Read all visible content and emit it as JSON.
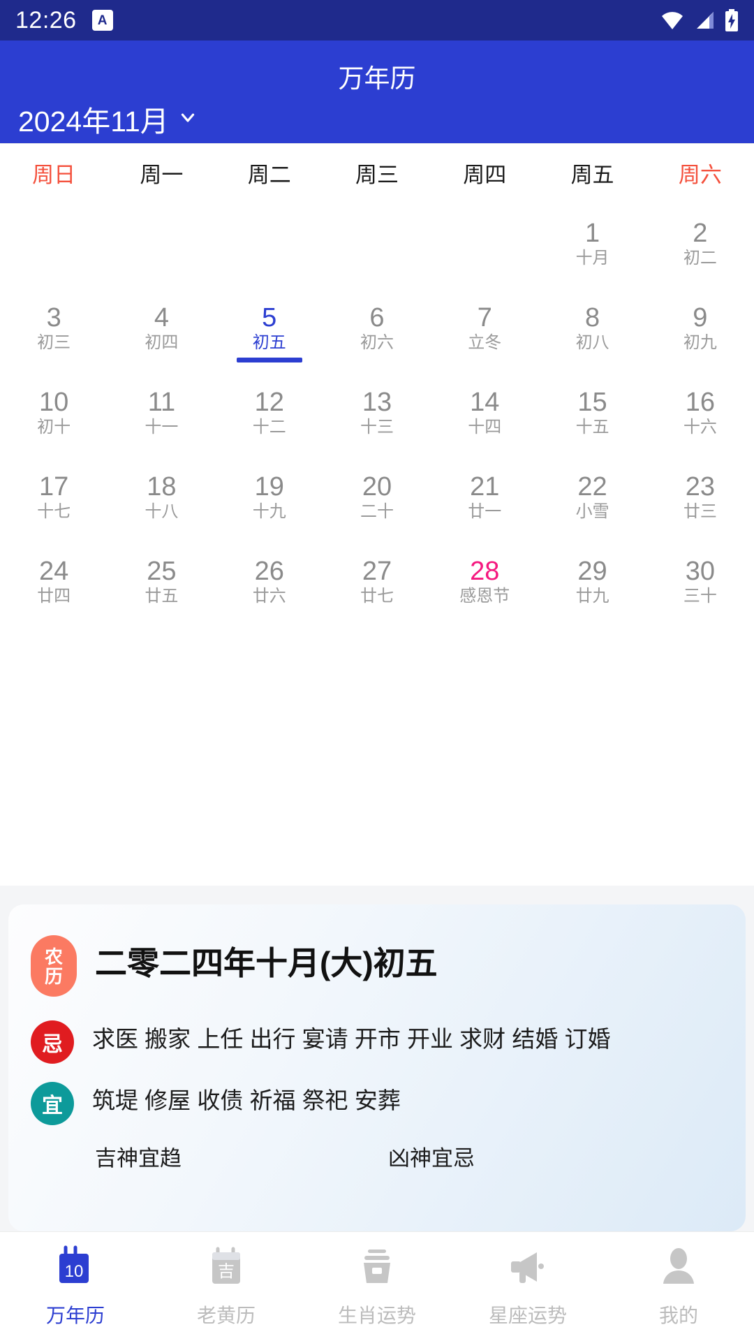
{
  "status_bar": {
    "time": "12:26",
    "app_icon_letter": "A",
    "icons": [
      "wifi-icon",
      "signal-icon",
      "battery-charging-icon"
    ]
  },
  "app_bar": {
    "title": "万年历",
    "month_label": "2024年11月",
    "chevron": "chevron-down-icon",
    "bg_color": "#2c3ed1"
  },
  "weekdays": [
    {
      "label": "周日",
      "weekend": true
    },
    {
      "label": "周一",
      "weekend": false
    },
    {
      "label": "周二",
      "weekend": false
    },
    {
      "label": "周三",
      "weekend": false
    },
    {
      "label": "周四",
      "weekend": false
    },
    {
      "label": "周五",
      "weekend": false
    },
    {
      "label": "周六",
      "weekend": true
    }
  ],
  "calendar": {
    "leading_blanks": 5,
    "days": [
      {
        "day": "1",
        "lunar": "十月",
        "selected": false,
        "festival": false
      },
      {
        "day": "2",
        "lunar": "初二",
        "selected": false,
        "festival": false
      },
      {
        "day": "3",
        "lunar": "初三",
        "selected": false,
        "festival": false
      },
      {
        "day": "4",
        "lunar": "初四",
        "selected": false,
        "festival": false
      },
      {
        "day": "5",
        "lunar": "初五",
        "selected": true,
        "festival": false
      },
      {
        "day": "6",
        "lunar": "初六",
        "selected": false,
        "festival": false
      },
      {
        "day": "7",
        "lunar": "立冬",
        "selected": false,
        "festival": false
      },
      {
        "day": "8",
        "lunar": "初八",
        "selected": false,
        "festival": false
      },
      {
        "day": "9",
        "lunar": "初九",
        "selected": false,
        "festival": false
      },
      {
        "day": "10",
        "lunar": "初十",
        "selected": false,
        "festival": false
      },
      {
        "day": "11",
        "lunar": "十一",
        "selected": false,
        "festival": false
      },
      {
        "day": "12",
        "lunar": "十二",
        "selected": false,
        "festival": false
      },
      {
        "day": "13",
        "lunar": "十三",
        "selected": false,
        "festival": false
      },
      {
        "day": "14",
        "lunar": "十四",
        "selected": false,
        "festival": false
      },
      {
        "day": "15",
        "lunar": "十五",
        "selected": false,
        "festival": false
      },
      {
        "day": "16",
        "lunar": "十六",
        "selected": false,
        "festival": false
      },
      {
        "day": "17",
        "lunar": "十七",
        "selected": false,
        "festival": false
      },
      {
        "day": "18",
        "lunar": "十八",
        "selected": false,
        "festival": false
      },
      {
        "day": "19",
        "lunar": "十九",
        "selected": false,
        "festival": false
      },
      {
        "day": "20",
        "lunar": "二十",
        "selected": false,
        "festival": false
      },
      {
        "day": "21",
        "lunar": "廿一",
        "selected": false,
        "festival": false
      },
      {
        "day": "22",
        "lunar": "小雪",
        "selected": false,
        "festival": false
      },
      {
        "day": "23",
        "lunar": "廿三",
        "selected": false,
        "festival": false
      },
      {
        "day": "24",
        "lunar": "廿四",
        "selected": false,
        "festival": false
      },
      {
        "day": "25",
        "lunar": "廿五",
        "selected": false,
        "festival": false
      },
      {
        "day": "26",
        "lunar": "廿六",
        "selected": false,
        "festival": false
      },
      {
        "day": "27",
        "lunar": "廿七",
        "selected": false,
        "festival": false
      },
      {
        "day": "28",
        "lunar": "感恩节",
        "selected": false,
        "festival": true
      },
      {
        "day": "29",
        "lunar": "廿九",
        "selected": false,
        "festival": false
      },
      {
        "day": "30",
        "lunar": "三十",
        "selected": false,
        "festival": false
      }
    ],
    "selected_color": "#2c3ed1",
    "festival_color": "#f5187f"
  },
  "lunar_card": {
    "badge_lunar_line1": "农",
    "badge_lunar_line2": "历",
    "title": "二零二四年十月(大)初五",
    "ji_badge": "忌",
    "ji_items": "求医 搬家 上任 出行 宴请 开市 开业 求财 结婚 订婚",
    "yi_badge": "宜",
    "yi_items": "筑堤 修屋 收债 祈福 祭祀 安葬",
    "good_gods_label": "吉神宜趋",
    "bad_gods_label": "凶神宜忌",
    "badge_lunar_color": "#fb7a62",
    "badge_ji_color": "#e01c20",
    "badge_yi_color": "#0d9a9a"
  },
  "bottom_nav": {
    "items": [
      {
        "label": "万年历",
        "icon": "calendar-icon",
        "active": true
      },
      {
        "label": "老黄历",
        "icon": "almanac-icon",
        "active": false
      },
      {
        "label": "生肖运势",
        "icon": "zodiac-icon",
        "active": false
      },
      {
        "label": "星座运势",
        "icon": "megaphone-icon",
        "active": false
      },
      {
        "label": "我的",
        "icon": "person-icon",
        "active": false
      }
    ],
    "active_color": "#2c3ed1",
    "inactive_color": "#c6c6c6"
  }
}
